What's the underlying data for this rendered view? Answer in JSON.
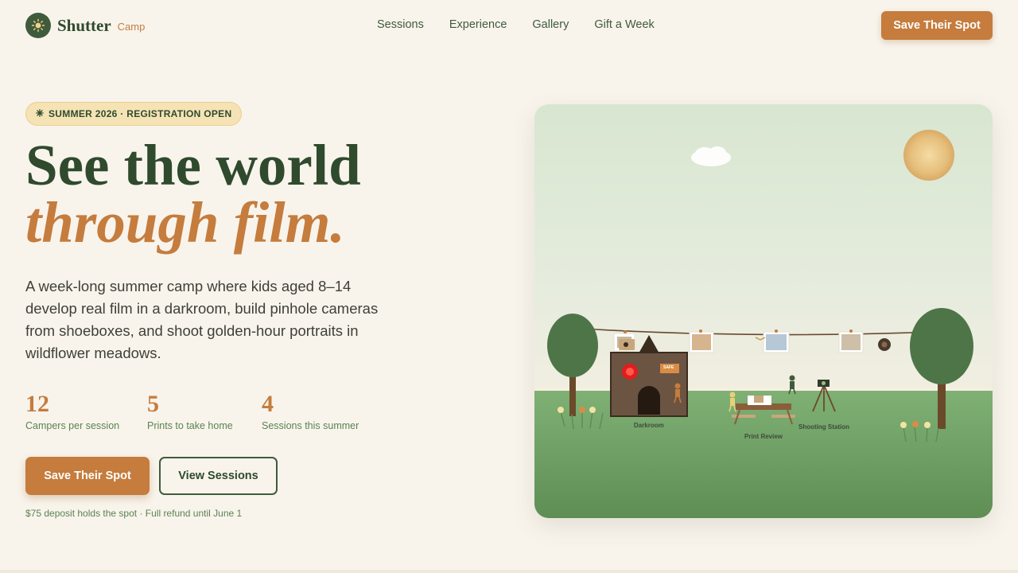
{
  "brand": {
    "name": "Shutter",
    "sub": "Camp",
    "icon": "sun-icon"
  },
  "nav": {
    "links": [
      "Sessions",
      "Experience",
      "Gallery",
      "Gift a Week"
    ],
    "cta": "Save Their Spot"
  },
  "hero": {
    "badge_icon": "sun-icon",
    "badge": "SUMMER 2026 · REGISTRATION OPEN",
    "title_line1": "See the world",
    "title_line2": "through film.",
    "lead": "A week-long summer camp where kids aged 8–14 develop real film in a darkroom, build pinhole cameras from shoeboxes, and shoot golden-hour portraits in wildflower meadows.",
    "stats": [
      {
        "value": "12",
        "label": "Campers per session"
      },
      {
        "value": "5",
        "label": "Prints to take home"
      },
      {
        "value": "4",
        "label": "Sessions this summer"
      }
    ],
    "primary_cta": "Save Their Spot",
    "secondary_cta": "View Sessions",
    "fineprint": "$75 deposit holds the spot · Full refund until June 1"
  },
  "scene": {
    "sign": "SAFE",
    "labels": {
      "darkroom": "Darkroom",
      "print_review": "Print Review",
      "shooting_station": "Shooting Station"
    }
  },
  "colors": {
    "background": "#f8f4ec",
    "forest": "#2f4a2d",
    "accent": "#c57c3d",
    "sage": "#5b8250",
    "badge": "#f5e3b5"
  }
}
